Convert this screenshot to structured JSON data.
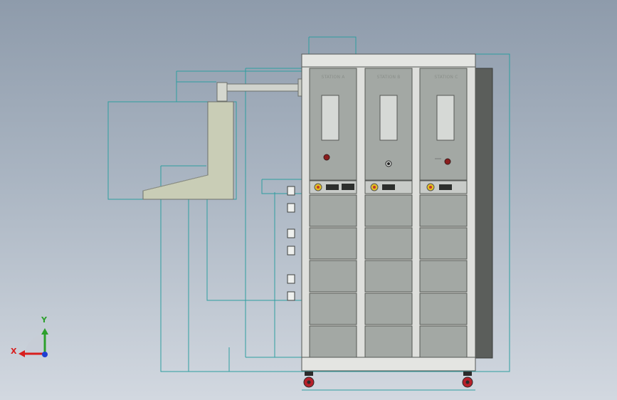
{
  "stations": [
    {
      "label": "STATION A"
    },
    {
      "label": "STATION B"
    },
    {
      "label": "STATION C"
    }
  ],
  "axes": {
    "x": "X",
    "y": "Y"
  },
  "colors": {
    "background_top": "#8e9bab",
    "background_bottom": "#d2d8e0",
    "construction_lines": "#2e9ea0",
    "panel": "#a3a8a4",
    "frame": "#dedfdc",
    "arm": "#c9cdb6",
    "side_panel": "#5b5e5b",
    "caster": "#b7202a",
    "axis_x": "#d81e1e",
    "axis_y": "#2ca02c",
    "axis_z": "#1f3fd1"
  }
}
